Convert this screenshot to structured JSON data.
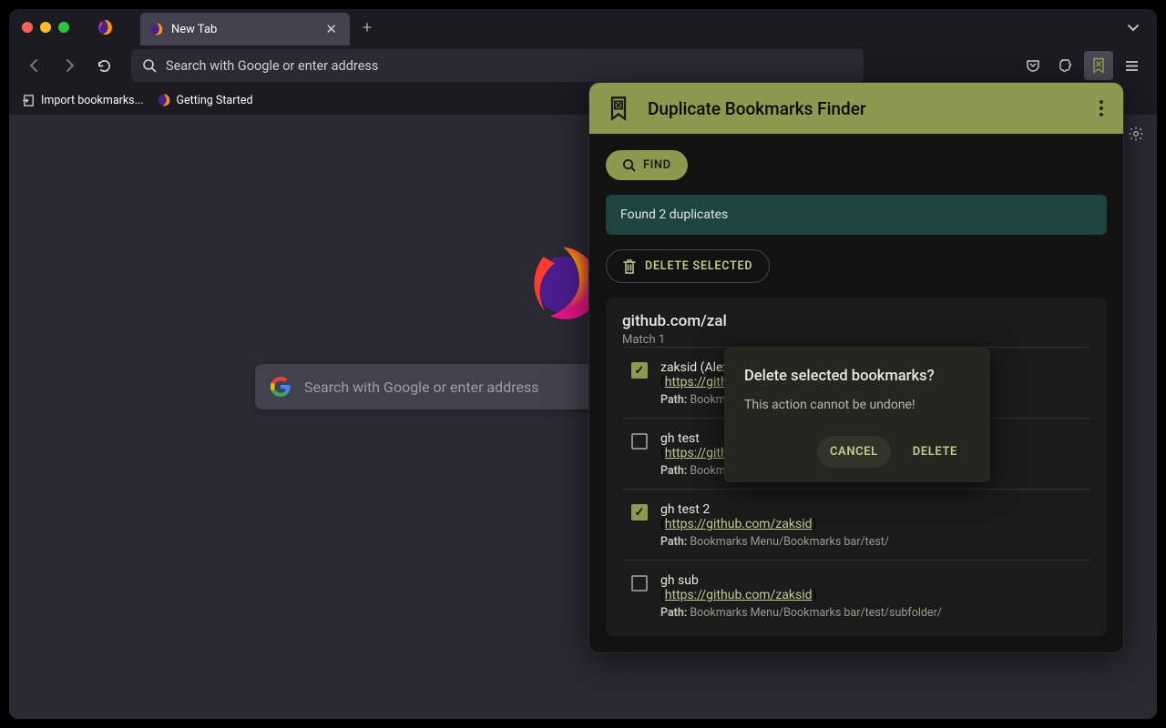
{
  "window": {
    "tab_title": "New Tab",
    "addressbar_placeholder": "Search with Google or enter address",
    "newtab_search_placeholder": "Search with Google or enter address",
    "brand_letter": "F"
  },
  "bookmarks_bar": {
    "import": "Import bookmarks...",
    "getting_started": "Getting Started"
  },
  "extension": {
    "title": "Duplicate Bookmarks Finder",
    "find_label": "FIND",
    "status": "Found 2 duplicates",
    "delete_selected": "DELETE SELECTED",
    "match": {
      "group_title": "github.com/zal",
      "group_sub": "Match 1",
      "items": [
        {
          "checked": true,
          "name": "zaksid (Alex",
          "url": "https://gith",
          "path_label": "Path:",
          "path": "Bookm"
        },
        {
          "checked": false,
          "name": "gh test",
          "url": "https://github.com/zaksid",
          "path_label": "Path:",
          "path": "Bookmarks Menu/Bookmarks bar/test/"
        },
        {
          "checked": true,
          "name": "gh test 2",
          "url": "https://github.com/zaksid",
          "path_label": "Path:",
          "path": "Bookmarks Menu/Bookmarks bar/test/"
        },
        {
          "checked": false,
          "name": "gh sub",
          "url": "https://github.com/zaksid",
          "path_label": "Path:",
          "path": "Bookmarks Menu/Bookmarks bar/test/subfolder/"
        }
      ]
    }
  },
  "dialog": {
    "title": "Delete selected bookmarks?",
    "message": "This action cannot be undone!",
    "cancel": "CANCEL",
    "confirm": "DELETE"
  }
}
